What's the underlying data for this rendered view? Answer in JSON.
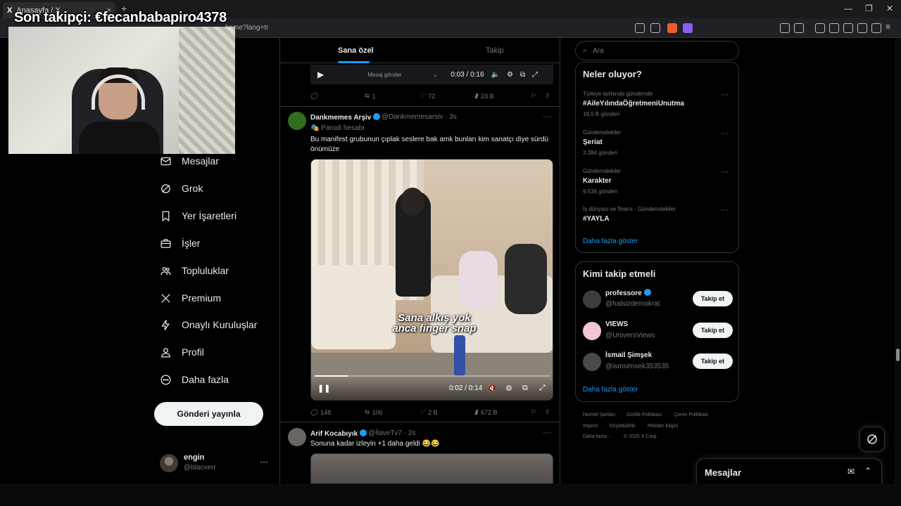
{
  "browser": {
    "tab_title": "Anasayfa / X",
    "tab_logo": "X",
    "url": "home?lang=tr",
    "new_tab": "+",
    "tab_close": "×",
    "window_controls": [
      "—",
      "❐",
      "✕"
    ]
  },
  "stream_overlay": {
    "text": "Son takipçi: €fecanbabapiro4378"
  },
  "nav": {
    "items": [
      {
        "label": "Mesajlar",
        "icon": "mail-icon"
      },
      {
        "label": "Grok",
        "icon": "grok-icon"
      },
      {
        "label": "Yer İşaretleri",
        "icon": "bookmark-icon"
      },
      {
        "label": "İşler",
        "icon": "briefcase-icon"
      },
      {
        "label": "Topluluklar",
        "icon": "communities-icon"
      },
      {
        "label": "Premium",
        "icon": "x-logo-icon"
      },
      {
        "label": "Onaylı Kuruluşlar",
        "icon": "lightning-icon"
      },
      {
        "label": "Profil",
        "icon": "person-icon"
      },
      {
        "label": "Daha fazla",
        "icon": "more-circle-icon"
      }
    ],
    "post_button": "Gönderi yayınla",
    "account": {
      "name": "engin",
      "handle": "@blacxerr",
      "more": "···"
    }
  },
  "timeline": {
    "tabs": [
      "Sana özel",
      "Takip"
    ],
    "top_video": {
      "placeholder": "Mesaj gönder",
      "time": "0:03 / 0:16",
      "actions": {
        "reply": "",
        "retweet": "1",
        "like": "72",
        "views": "23 B"
      }
    },
    "tweets": [
      {
        "name": "Dankmemes Arşiv",
        "handle": "@Dankmemesarsiv · 3s",
        "label": "Parodi hesabı",
        "text": "Bu manifest grubunun çıplak seslere bak amk bunları kim sanatçı diye sürdü önümüze",
        "caption": "Sana alkış yok anca finger snap",
        "time": "0:02 / 0:14",
        "actions": {
          "reply": "148",
          "retweet": "106",
          "like": "2 B",
          "views": "672 B"
        }
      },
      {
        "name": "Arif Kocabıyık",
        "handle": "@İlaveTv7 · 2s",
        "text": "Sonuna kadar izleyin +1 daha geldi 😂😂"
      }
    ]
  },
  "right": {
    "search_placeholder": "Ara",
    "trends_title": "Neler oluyor?",
    "trends": [
      {
        "meta": "Türkiye tarihinde gündemde",
        "name": "#AileYılındaÖğretmeniUnutma",
        "count": "18,5 B gönderi"
      },
      {
        "meta": "Gündemdekiler",
        "name": "Şeriat",
        "count": "3.384 gönderi"
      },
      {
        "meta": "Gündemdekiler",
        "name": "Karakter",
        "count": "9.536 gönderi"
      },
      {
        "meta": "İş dünyası ve finans · Gündemdekiler",
        "name": "#YAYLA",
        "count": ""
      }
    ],
    "trends_more": "Daha fazla göster",
    "who_title": "Kimi takip etmeli",
    "who": [
      {
        "name": "professore",
        "handle": "@halsizdemokrat",
        "button": "Takip et",
        "avatar_color": "#3a3d40"
      },
      {
        "name": "VIEWS",
        "handle": "@UniversViews",
        "button": "Takip et",
        "avatar_color": "#f2c6d6"
      },
      {
        "name": "İsmail Şimşek",
        "handle": "@ismsimsek353535",
        "button": "Takip et",
        "avatar_color": "#4a4a4a"
      }
    ],
    "who_more": "Daha fazla göster",
    "footer": [
      "Hizmet Şartları",
      "Gizlilik Politikası",
      "Çerez Politikası",
      "Imprint",
      "Erişilebilirlik",
      "Reklam bilgisi",
      "Daha fazla ···",
      "© 2025 X Corp."
    ],
    "messages_drawer": "Mesajlar"
  },
  "colors": {
    "accent": "#1d9bf0",
    "bg": "#000000",
    "border": "#2f3336",
    "muted": "#71767b"
  }
}
